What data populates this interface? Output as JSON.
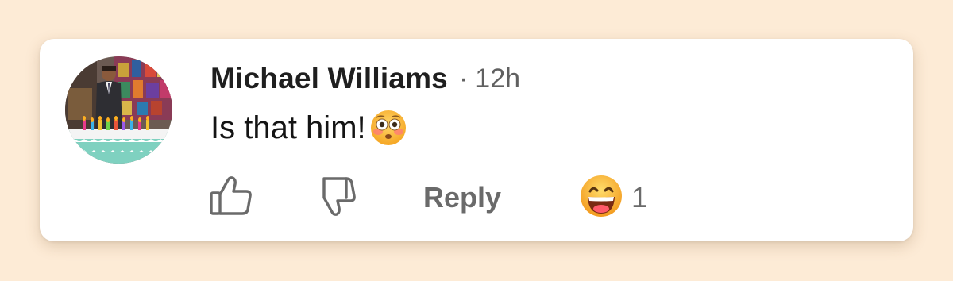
{
  "comment": {
    "author": "Michael Williams",
    "separator": "·",
    "time": "12h",
    "text": "Is that him!",
    "text_emoji": "flushed-face"
  },
  "actions": {
    "like_icon": "thumbs-up-icon",
    "dislike_icon": "thumbs-down-icon",
    "reply_label": "Reply",
    "reaction_emoji": "grinning-face",
    "reaction_count": "1"
  },
  "colors": {
    "background": "#fdebd6",
    "card": "#ffffff",
    "author_text": "#1f1f1f",
    "muted_text": "#606060",
    "icon_gray": "#6a6a6a"
  }
}
